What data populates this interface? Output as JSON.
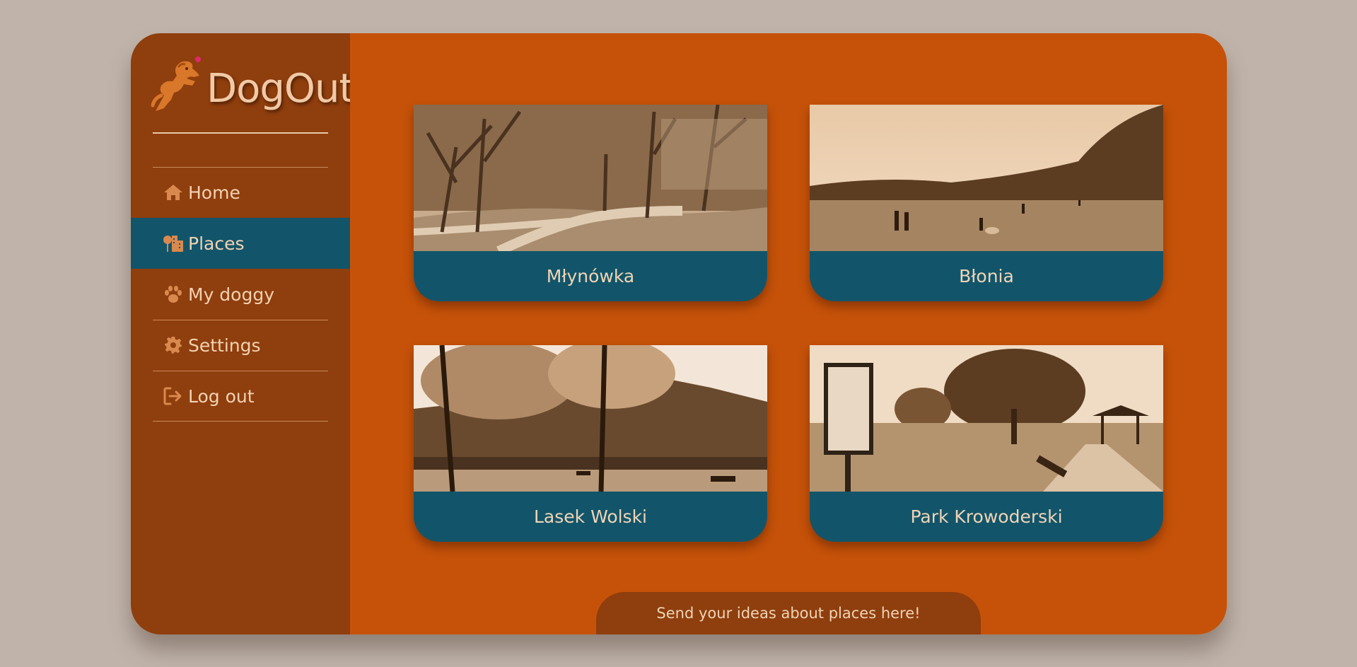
{
  "app": {
    "name": "DogOut"
  },
  "sidebar": {
    "items": [
      {
        "label": "Home",
        "icon": "home-icon",
        "active": false
      },
      {
        "label": "Places",
        "icon": "places-icon",
        "active": true
      },
      {
        "label": "My doggy",
        "icon": "paw-icon",
        "active": false
      },
      {
        "label": "Settings",
        "icon": "gear-icon",
        "active": false
      },
      {
        "label": "Log out",
        "icon": "logout-icon",
        "active": false
      }
    ]
  },
  "places": [
    {
      "name": "Młynówka"
    },
    {
      "name": "Błonia"
    },
    {
      "name": "Lasek Wolski"
    },
    {
      "name": "Park Krowoderski"
    }
  ],
  "footer": {
    "ideas_label": "Send your ideas about places here!"
  },
  "colors": {
    "page_bg": "#c0b4aa",
    "sidebar_bg": "#8f3e0d",
    "main_bg": "#c65209",
    "accent_teal": "#12556a",
    "text_light": "#f3d2b2"
  }
}
